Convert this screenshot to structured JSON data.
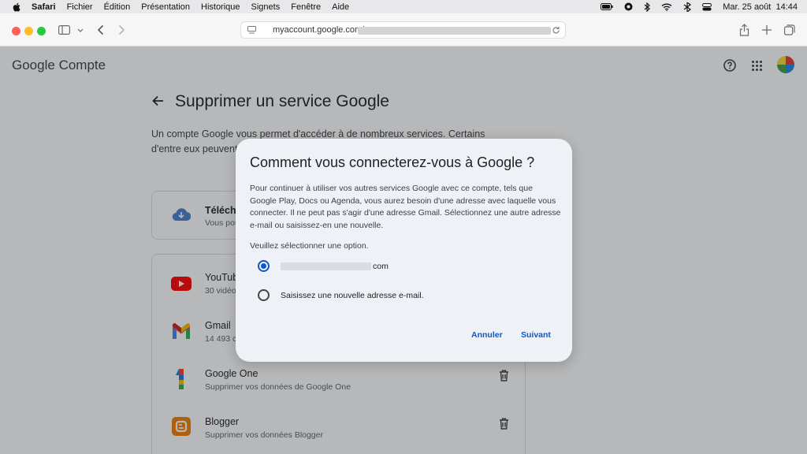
{
  "menubar": {
    "app": "Safari",
    "items": [
      "Fichier",
      "Édition",
      "Présentation",
      "Historique",
      "Signets",
      "Fenêtre",
      "Aide"
    ],
    "clock": "Mar. 25 août  14:44"
  },
  "browser": {
    "url": "myaccount.google.com/"
  },
  "header": {
    "brand_google": "Google",
    "brand_compte": "Compte"
  },
  "page": {
    "title": "Supprimer un service Google",
    "intro": "Un compte Google vous permet d'accéder à de nombreux services. Certains d'entre eux peuvent être supprimés de manière individuelle."
  },
  "services": [
    {
      "name": "Télécha",
      "sub": "Vous pou"
    },
    {
      "name": "YouTub",
      "sub": "30 vidéo"
    },
    {
      "name": "Gmail",
      "sub": "14 493 c"
    },
    {
      "name": "Google One",
      "sub": "Supprimer vos données de Google One"
    },
    {
      "name": "Blogger",
      "sub": "Supprimer vos données Blogger"
    }
  ],
  "dialog": {
    "title": "Comment vous connecterez-vous à Google ?",
    "body": "Pour continuer à utiliser vos autres services Google avec ce compte, tels que Google Play, Docs ou Agenda, vous aurez besoin d'une adresse avec laquelle vous connecter. Il ne peut pas s'agir d'une adresse Gmail. Sélectionnez une autre adresse e-mail ou saisissez-en une nouvelle.",
    "prompt": "Veuillez sélectionner une option.",
    "option1_suffix": "com",
    "option2": "Saisissez une nouvelle adresse e-mail.",
    "cancel": "Annuler",
    "next": "Suivant"
  },
  "colors": {
    "accent": "#0b57d0",
    "dialog_bg": "#eef1f6"
  }
}
